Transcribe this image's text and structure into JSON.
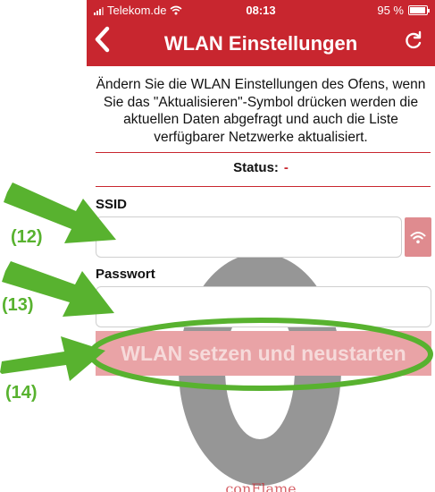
{
  "status_bar": {
    "carrier": "Telekom.de",
    "time": "08:13",
    "battery": "95 %"
  },
  "navbar": {
    "back_icon": "chevron-left-icon",
    "title": "WLAN Einstellungen",
    "refresh_icon": "refresh-icon"
  },
  "intro_text": "Ändern Sie die WLAN Einstellungen des Ofens, wenn Sie das \"Aktualisieren\"-Symbol drücken werden die aktuellen Daten abgefragt und auch die Liste verfügbarer Netzwerke aktualisiert.",
  "status": {
    "label": "Status:",
    "value": "-"
  },
  "ssid": {
    "label": "SSID",
    "value": "",
    "button_icon": "wifi-icon"
  },
  "password": {
    "label": "Passwort",
    "value": ""
  },
  "submit_label": "WLAN setzen und neustarten",
  "brand": {
    "name": "conFlame"
  },
  "annotations": [
    "(12)",
    "(13)",
    "(14)"
  ],
  "colors": {
    "primary": "#c8262f",
    "button_disabled": "#e9a3a6",
    "annotation": "#58b22f"
  }
}
